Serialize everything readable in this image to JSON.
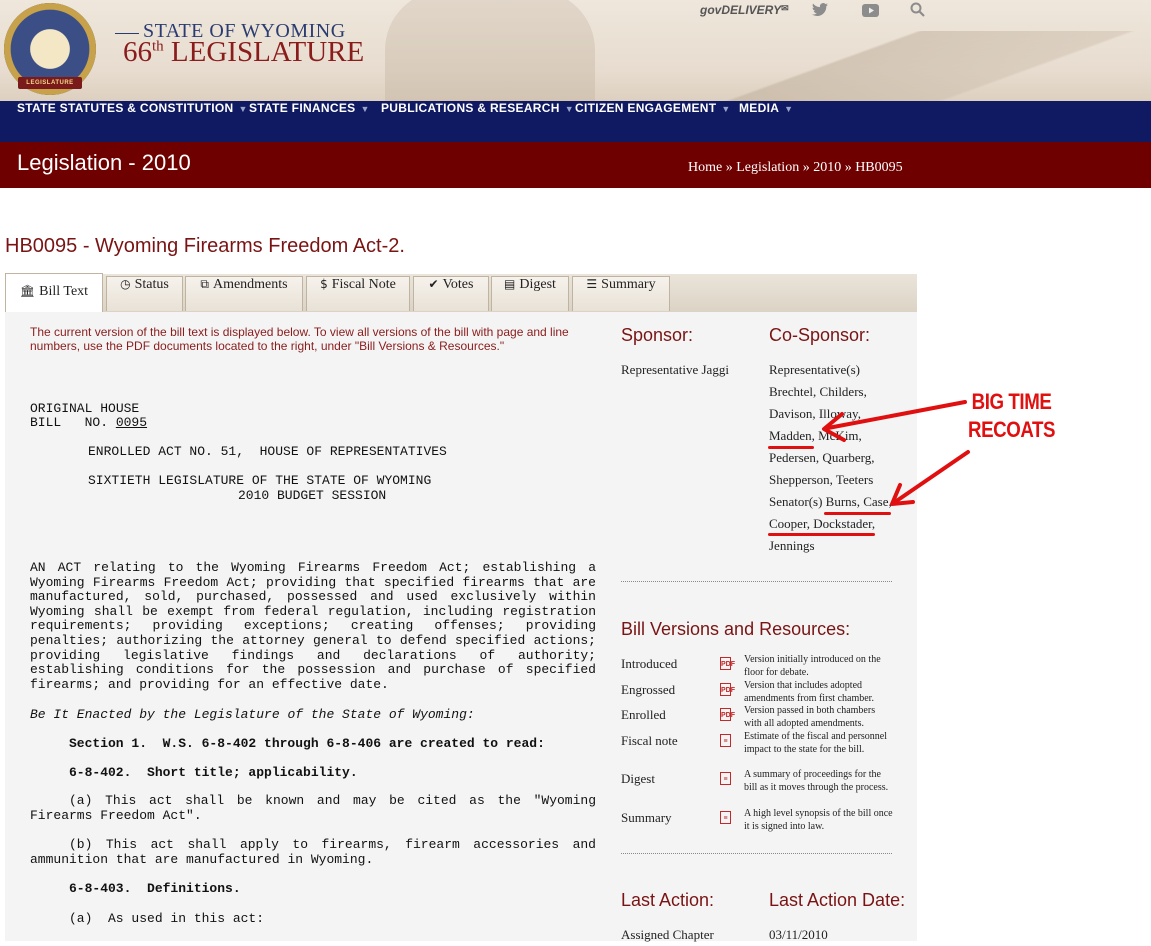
{
  "header": {
    "seal_text": "LEGISLATURE",
    "state_label": "STATE OF WYOMING",
    "legislature_number": "66",
    "legislature_suffix": "th",
    "legislature_label": "LEGISLATURE",
    "govdelivery": "govDELIVERY",
    "icons": [
      "twitter-icon",
      "youtube-icon",
      "search-icon"
    ]
  },
  "nav": {
    "items": [
      {
        "label": "STATE STATUTES & CONSTITUTION"
      },
      {
        "label": "STATE FINANCES"
      },
      {
        "label": "PUBLICATIONS & RESEARCH"
      },
      {
        "label": "CITIZEN ENGAGEMENT"
      },
      {
        "label": "MEDIA"
      }
    ]
  },
  "titlebar": {
    "title": "Legislation - 2010",
    "breadcrumb": "Home » Legislation » 2010 » HB0095"
  },
  "bill": {
    "title": "HB0095 - Wyoming Firearms Freedom Act-2."
  },
  "tabs": [
    {
      "label": "Bill Text",
      "icon": "bank-icon"
    },
    {
      "label": "Status",
      "icon": "clock-icon"
    },
    {
      "label": "Amendments",
      "icon": "copy-icon"
    },
    {
      "label": "Fiscal Note",
      "icon": "dollar-icon"
    },
    {
      "label": "Votes",
      "icon": "check-icon"
    },
    {
      "label": "Digest",
      "icon": "document-icon"
    },
    {
      "label": "Summary",
      "icon": "list-icon"
    }
  ],
  "billtext": {
    "notice": "The current version of the bill text is displayed below. To view all versions of the bill with page and line numbers, use the PDF documents located to the right, under \"Bill Versions & Resources.\"",
    "line1": "ORIGINAL HOUSE",
    "line2a": "BILL   NO. ",
    "bill_no": "0095",
    "line3": "ENROLLED ACT NO. 51,  HOUSE OF REPRESENTATIVES",
    "line4": "SIXTIETH LEGISLATURE OF THE STATE OF WYOMING",
    "line5": "2010 BUDGET SESSION",
    "act": "AN ACT relating to the Wyoming Firearms Freedom Act; establishing a Wyoming Firearms Freedom Act; providing that specified firearms that are manufactured, sold, purchased, possessed and used exclusively within Wyoming shall be exempt from federal regulation, including registration requirements; providing exceptions; creating offenses; providing penalties; authorizing the attorney general to defend specified actions; providing legislative findings and declarations of authority; establishing conditions for the possession and purchase of specified firearms; and providing for an effective date.",
    "enacted": "Be It Enacted by the Legislature of the State of Wyoming:",
    "section1": "Section 1.  W.S. 6-8-402 through 6-8-406 are created to read:",
    "s402": "6-8-402.  Short title; applicability.",
    "s402a": "(a)  This act shall be known and may be cited as the \"Wyoming Firearms Freedom Act\".",
    "s402b": "(b)  This act shall apply to firearms, firearm accessories and ammunition that are manufactured in Wyoming.",
    "s403": "6-8-403.  Definitions.",
    "s403a": "(a)  As used in this act:"
  },
  "sidebar": {
    "sponsor_heading": "Sponsor:",
    "sponsor": "Representative Jaggi",
    "cosponsor_heading": "Co-Sponsor:",
    "cosponsor_lines": [
      "Representative(s)",
      "Brechtel, Childers,",
      "Davison, Illoway,",
      "Madden, McKim,",
      "Pedersen, Quarberg,",
      "Shepperson, Teeters",
      "Senator(s) Burns, Case,",
      "Cooper, Dockstader,",
      "Jennings"
    ],
    "versions_heading": "Bill Versions and Resources:",
    "versions": [
      {
        "label": "Introduced",
        "icon": "pdf-icon",
        "desc": "Version initially introduced on the floor for debate."
      },
      {
        "label": "Engrossed",
        "icon": "pdf-icon",
        "desc": "Version that includes adopted amendments from first chamber."
      },
      {
        "label": "Enrolled",
        "icon": "pdf-icon",
        "desc": "Version passed in both chambers with all adopted amendments."
      },
      {
        "label": "Fiscal note",
        "icon": "document-icon",
        "desc": "Estimate of the fiscal and personnel impact to the state for the bill."
      },
      {
        "label": "Digest",
        "icon": "document-icon",
        "desc": "A summary of proceedings for the bill as it moves through the process."
      },
      {
        "label": "Summary",
        "icon": "document-icon",
        "desc": "A high level synopsis of the bill once it is signed into law."
      }
    ],
    "last_action_heading": "Last Action:",
    "last_action": "Assigned Chapter",
    "last_action_date_heading": "Last Action Date:",
    "last_action_date": "03/11/2010"
  },
  "annotation": {
    "line1": "BIG TIME",
    "line2": "RECOATS",
    "color": "#e01010"
  }
}
